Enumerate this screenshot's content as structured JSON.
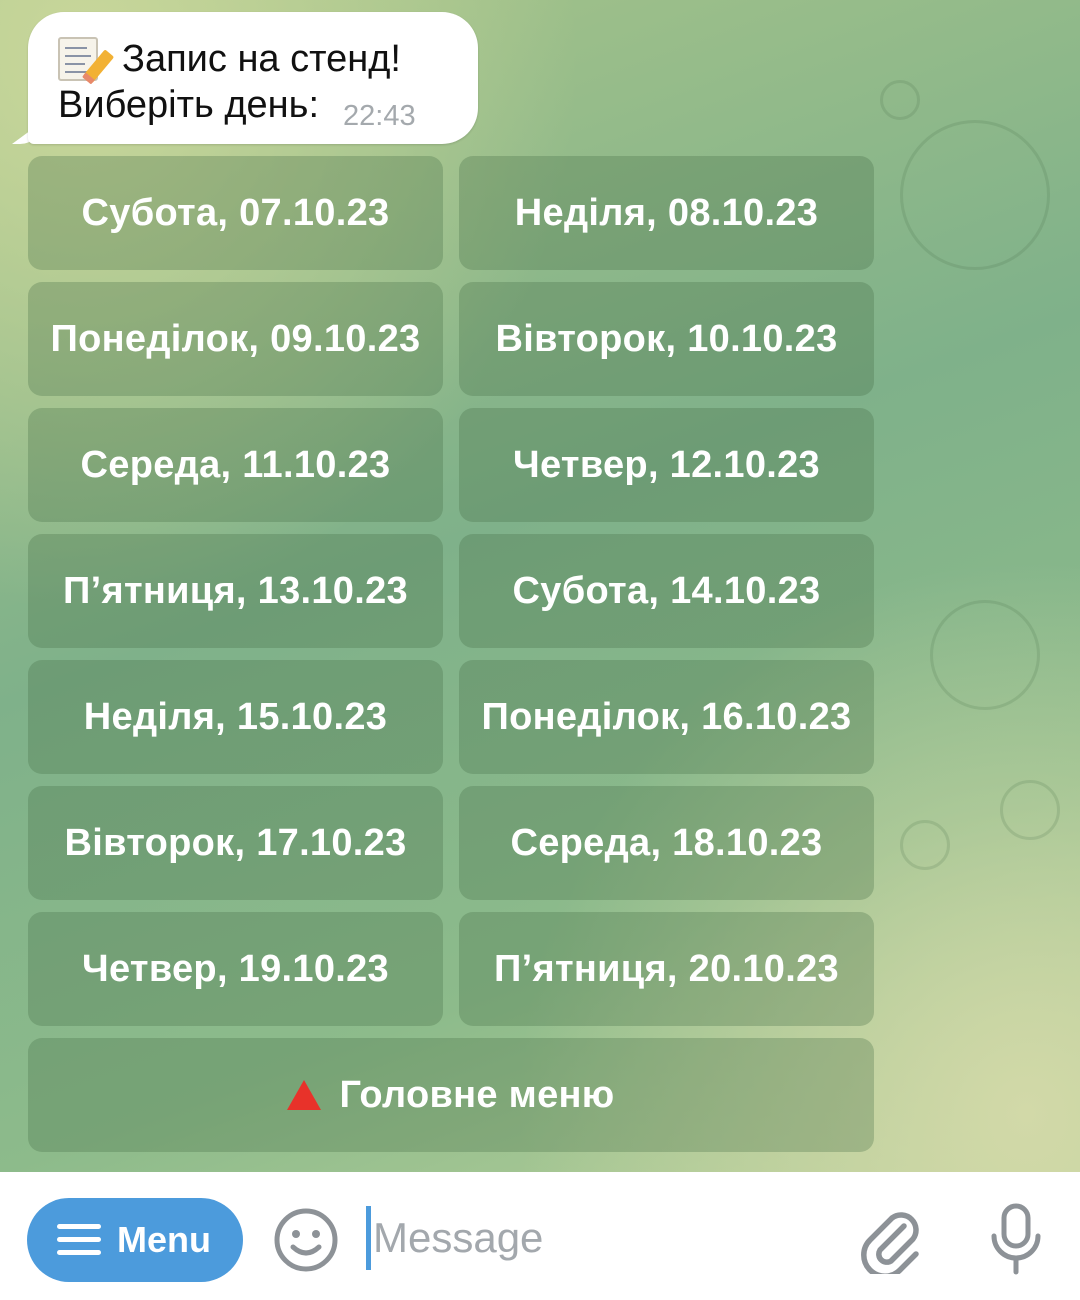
{
  "message": {
    "emoji_icon": "memo-icon",
    "line1": "Запис на стенд!",
    "line2": "Виберіть день:",
    "time": "22:43"
  },
  "keyboard": {
    "days": [
      "Субота, 07.10.23",
      "Неділя, 08.10.23",
      "Понеділок, 09.10.23",
      "Вівторок, 10.10.23",
      "Середа, 11.10.23",
      "Четвер, 12.10.23",
      "П’ятниця, 13.10.23",
      "Субота, 14.10.23",
      "Неділя, 15.10.23",
      "Понеділок, 16.10.23",
      "Вівторок, 17.10.23",
      "Середа, 18.10.23",
      "Четвер, 19.10.23",
      "П’ятниця, 20.10.23"
    ],
    "main_menu": {
      "icon": "red-triangle-icon",
      "label": "Головне меню"
    }
  },
  "input_bar": {
    "menu_label": "Menu",
    "placeholder": "Message",
    "icons": [
      "hamburger-icon",
      "emoji-icon",
      "paperclip-icon",
      "microphone-icon"
    ]
  },
  "colors": {
    "accent": "#4c9bdc",
    "button_fill": "rgba(70,110,70,0.30)",
    "triangle": "#e8322a"
  }
}
